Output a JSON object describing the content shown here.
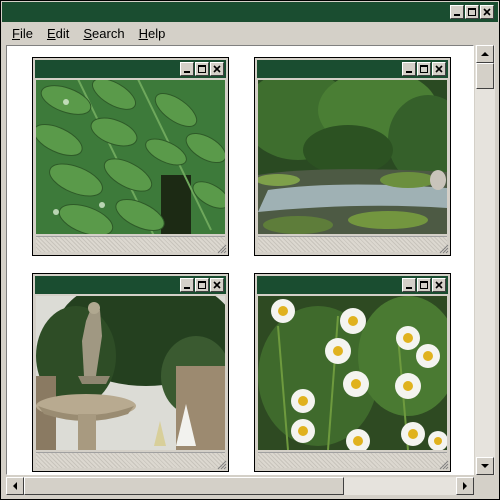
{
  "window": {
    "title_color": "#1a4d30",
    "buttons": [
      "minimize-icon",
      "maximize-icon",
      "close-icon"
    ]
  },
  "menu": {
    "items": [
      {
        "accel": "F",
        "rest": "ile"
      },
      {
        "accel": "E",
        "rest": "dit"
      },
      {
        "accel": "S",
        "rest": "earch"
      },
      {
        "accel": "H",
        "rest": "elp"
      }
    ]
  },
  "documents": [
    {
      "subject": "fern leaves with water droplets"
    },
    {
      "subject": "forest stream with rocks"
    },
    {
      "subject": "stone fountain with statue"
    },
    {
      "subject": "white daisies"
    }
  ]
}
